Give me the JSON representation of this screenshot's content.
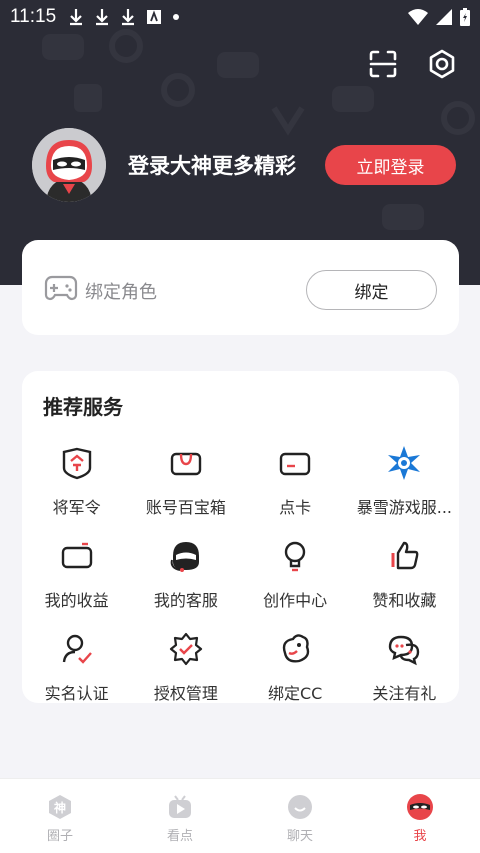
{
  "status_bar": {
    "time": "11:15"
  },
  "header": {
    "login_prompt": "登录大神更多精彩",
    "login_button": "立即登录"
  },
  "bind_card": {
    "label": "绑定角色",
    "button": "绑定"
  },
  "services": {
    "title": "推荐服务",
    "items": [
      {
        "label": "将军令",
        "icon": "shield-token-icon"
      },
      {
        "label": "账号百宝箱",
        "icon": "treasure-box-icon"
      },
      {
        "label": "点卡",
        "icon": "card-icon"
      },
      {
        "label": "暴雪游戏服...",
        "icon": "blizzard-icon"
      },
      {
        "label": "我的收益",
        "icon": "wallet-icon"
      },
      {
        "label": "我的客服",
        "icon": "support-icon"
      },
      {
        "label": "创作中心",
        "icon": "bulb-icon"
      },
      {
        "label": "赞和收藏",
        "icon": "thumbs-up-icon"
      },
      {
        "label": "实名认证",
        "icon": "verified-user-icon"
      },
      {
        "label": "授权管理",
        "icon": "authorization-icon"
      },
      {
        "label": "绑定CC",
        "icon": "cc-icon"
      },
      {
        "label": "关注有礼",
        "icon": "chat-bubbles-icon"
      }
    ]
  },
  "tabbar": {
    "tabs": [
      {
        "label": "圈子",
        "active": false
      },
      {
        "label": "看点",
        "active": false
      },
      {
        "label": "聊天",
        "active": false
      },
      {
        "label": "我",
        "active": true
      }
    ]
  },
  "colors": {
    "accent": "#e8454a",
    "header_bg": "#2b2c36"
  }
}
